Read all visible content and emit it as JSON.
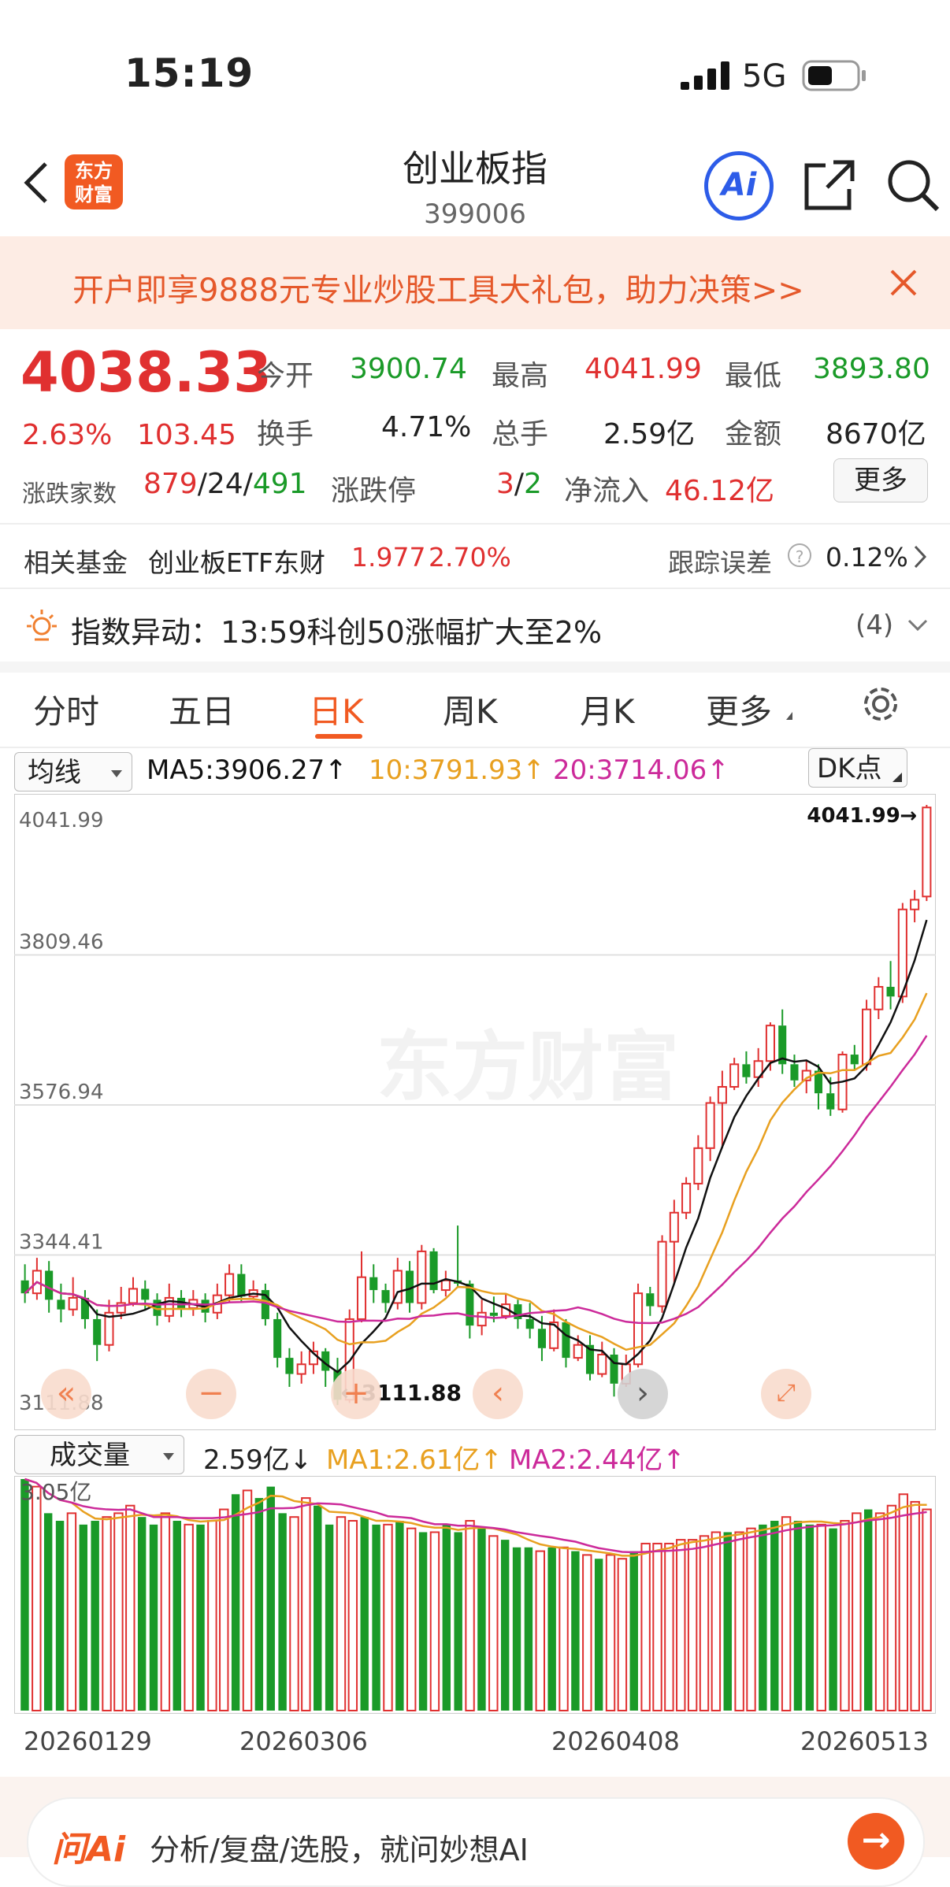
{
  "status_bar": {
    "time": "15:19",
    "network": "5G"
  },
  "header": {
    "title": "创业板指",
    "code": "399006",
    "logo_line1": "东方",
    "logo_line2": "财富",
    "ai_label": "Ai"
  },
  "banner": {
    "text": "开户即享9888元专业炒股工具大礼包，助力决策>>"
  },
  "quote": {
    "price": "4038.33",
    "change_pct": "2.63%",
    "change": "103.45",
    "open_label": "今开",
    "open": "3900.74",
    "high_label": "最高",
    "high": "4041.99",
    "low_label": "最低",
    "low": "3893.80",
    "turnover_label": "换手",
    "turnover": "4.71%",
    "volume_label": "总手",
    "volume": "2.59亿",
    "amount_label": "金额",
    "amount": "8670亿",
    "advdec_label": "涨跌家数",
    "adv": "879",
    "flat": "24",
    "dec": "491",
    "limit_label": "涨跌停",
    "limit_up": "3",
    "limit_down": "2",
    "netflow_label": "净流入",
    "netflow": "46.12亿",
    "more_label": "更多"
  },
  "fund": {
    "label": "相关基金",
    "name": "创业板ETF东财",
    "price": "1.977",
    "pct": "2.70%",
    "track_label": "跟踪误差",
    "track_value": "0.12%"
  },
  "alert": {
    "text": "指数异动：13:59科创50涨幅扩大至2%",
    "count": "(4)"
  },
  "tabs": [
    "分时",
    "五日",
    "日K",
    "周K",
    "月K",
    "更多"
  ],
  "kline_bar": {
    "selector": "均线",
    "ma5": "MA5:3906.27",
    "ma10": "10:3791.93",
    "ma20": "20:3714.06",
    "dk": "DK点"
  },
  "volume_bar": {
    "selector": "成交量",
    "vol": "2.59亿",
    "ma1": "MA1:2.61亿",
    "ma2": "MA2:2.44亿",
    "max_label": "3.05亿"
  },
  "colors": {
    "up": "#e03030",
    "down": "#1a9a28",
    "ma5": "#111111",
    "ma10": "#e8a020",
    "ma20": "#cc2a9a",
    "accent": "#f15a22"
  },
  "chart_data": {
    "type": "candlestick",
    "y_ticks": [
      "4041.99",
      "3809.46",
      "3576.94",
      "3344.41",
      "3111.88"
    ],
    "ylim": [
      3111.88,
      4041.99
    ],
    "max_label": "4041.99",
    "min_label": "3111.88",
    "x_labels": [
      "20260129",
      "20260306",
      "20260408",
      "20260513"
    ],
    "candles": [
      [
        3305,
        3285,
        3330,
        3270
      ],
      [
        3285,
        3320,
        3340,
        3275
      ],
      [
        3320,
        3275,
        3335,
        3255
      ],
      [
        3275,
        3260,
        3300,
        3240
      ],
      [
        3260,
        3278,
        3310,
        3250
      ],
      [
        3278,
        3245,
        3290,
        3230
      ],
      [
        3245,
        3205,
        3260,
        3180
      ],
      [
        3205,
        3255,
        3275,
        3195
      ],
      [
        3255,
        3270,
        3295,
        3245
      ],
      [
        3270,
        3292,
        3310,
        3265
      ],
      [
        3292,
        3275,
        3305,
        3260
      ],
      [
        3275,
        3250,
        3285,
        3235
      ],
      [
        3250,
        3278,
        3300,
        3240
      ],
      [
        3278,
        3262,
        3290,
        3248
      ],
      [
        3262,
        3275,
        3290,
        3250
      ],
      [
        3275,
        3255,
        3285,
        3240
      ],
      [
        3255,
        3282,
        3300,
        3245
      ],
      [
        3282,
        3315,
        3330,
        3270
      ],
      [
        3315,
        3280,
        3330,
        3270
      ],
      [
        3280,
        3290,
        3305,
        3275
      ],
      [
        3290,
        3245,
        3300,
        3235
      ],
      [
        3245,
        3185,
        3255,
        3170
      ],
      [
        3185,
        3160,
        3200,
        3140
      ],
      [
        3160,
        3175,
        3195,
        3145
      ],
      [
        3175,
        3195,
        3210,
        3160
      ],
      [
        3195,
        3165,
        3200,
        3140
      ],
      [
        3165,
        3120,
        3185,
        3112
      ],
      [
        3120,
        3245,
        3260,
        3115
      ],
      [
        3245,
        3310,
        3350,
        3240
      ],
      [
        3310,
        3290,
        3330,
        3270
      ],
      [
        3290,
        3270,
        3300,
        3255
      ],
      [
        3270,
        3320,
        3340,
        3260
      ],
      [
        3320,
        3270,
        3335,
        3255
      ],
      [
        3270,
        3350,
        3360,
        3260
      ],
      [
        3350,
        3290,
        3355,
        3285
      ],
      [
        3290,
        3305,
        3320,
        3280
      ],
      [
        3305,
        3300,
        3390,
        3295
      ],
      [
        3300,
        3235,
        3305,
        3215
      ],
      [
        3235,
        3255,
        3275,
        3220
      ],
      [
        3255,
        3250,
        3280,
        3240
      ],
      [
        3250,
        3268,
        3285,
        3245
      ],
      [
        3268,
        3245,
        3275,
        3230
      ],
      [
        3245,
        3230,
        3270,
        3215
      ],
      [
        3230,
        3200,
        3250,
        3180
      ],
      [
        3200,
        3240,
        3260,
        3195
      ],
      [
        3240,
        3185,
        3245,
        3170
      ],
      [
        3185,
        3205,
        3220,
        3180
      ],
      [
        3205,
        3160,
        3220,
        3150
      ],
      [
        3160,
        3190,
        3210,
        3155
      ],
      [
        3190,
        3145,
        3200,
        3125
      ],
      [
        3145,
        3175,
        3190,
        3140
      ],
      [
        3175,
        3285,
        3300,
        3170
      ],
      [
        3285,
        3265,
        3295,
        3250
      ],
      [
        3265,
        3365,
        3375,
        3255
      ],
      [
        3365,
        3410,
        3430,
        3300
      ],
      [
        3410,
        3455,
        3465,
        3400
      ],
      [
        3455,
        3510,
        3530,
        3445
      ],
      [
        3510,
        3580,
        3590,
        3490
      ],
      [
        3580,
        3605,
        3630,
        3510
      ],
      [
        3605,
        3640,
        3650,
        3600
      ],
      [
        3640,
        3620,
        3660,
        3610
      ],
      [
        3620,
        3645,
        3665,
        3605
      ],
      [
        3645,
        3700,
        3705,
        3630
      ],
      [
        3700,
        3640,
        3725,
        3625
      ],
      [
        3640,
        3615,
        3655,
        3605
      ],
      [
        3615,
        3630,
        3645,
        3595
      ],
      [
        3630,
        3595,
        3640,
        3570
      ],
      [
        3595,
        3570,
        3620,
        3560
      ],
      [
        3570,
        3655,
        3660,
        3565
      ],
      [
        3655,
        3640,
        3670,
        3630
      ],
      [
        3640,
        3725,
        3740,
        3630
      ],
      [
        3725,
        3760,
        3775,
        3710
      ],
      [
        3760,
        3745,
        3800,
        3725
      ],
      [
        3745,
        3880,
        3890,
        3735
      ],
      [
        3880,
        3895,
        3910,
        3860
      ],
      [
        3900,
        4038,
        4042,
        3893
      ]
    ],
    "volume_ylim": [
      0,
      3.05
    ],
    "volumes": [
      3.05,
      2.95,
      2.6,
      2.5,
      2.6,
      2.45,
      2.5,
      2.55,
      2.6,
      2.7,
      2.55,
      2.45,
      2.6,
      2.5,
      2.45,
      2.45,
      2.5,
      2.65,
      2.85,
      2.9,
      2.8,
      2.95,
      2.6,
      2.55,
      2.8,
      2.7,
      2.45,
      2.55,
      2.5,
      2.55,
      2.45,
      2.45,
      2.5,
      2.4,
      2.35,
      2.35,
      2.45,
      2.35,
      2.5,
      2.4,
      2.3,
      2.25,
      2.15,
      2.15,
      2.1,
      2.15,
      2.15,
      2.1,
      2.05,
      2.0,
      2.05,
      2.0,
      2.1,
      2.2,
      2.2,
      2.2,
      2.25,
      2.25,
      2.3,
      2.35,
      2.35,
      2.35,
      2.4,
      2.45,
      2.5,
      2.55,
      2.5,
      2.45,
      2.45,
      2.4,
      2.5,
      2.6,
      2.65,
      2.6,
      2.7,
      2.85,
      2.75,
      2.65
    ]
  }
}
